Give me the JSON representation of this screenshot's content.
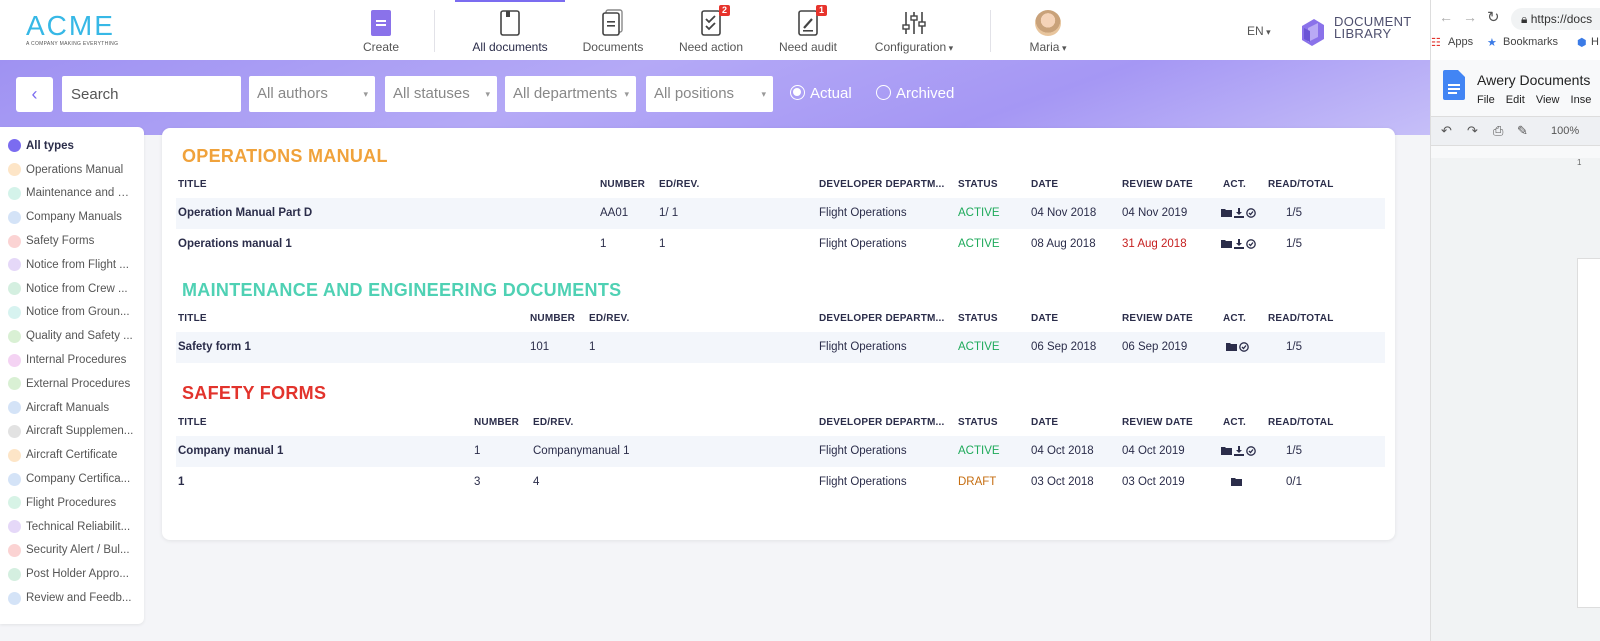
{
  "logo": {
    "word": "ACME",
    "tagline": "A COMPANY MAKING EVERYTHING"
  },
  "nav": {
    "create": "Create",
    "all_documents": "All documents",
    "documents": "Documents",
    "need_action": "Need action",
    "need_action_badge": "2",
    "need_audit": "Need audit",
    "need_audit_badge": "1",
    "configuration": "Configuration",
    "user": "Maria",
    "language": "EN",
    "doclib_line1": "DOCUMENT",
    "doclib_line2": "LIBRARY"
  },
  "filters": {
    "search_placeholder": "Search",
    "authors": "All authors",
    "statuses": "All statuses",
    "departments": "All departments",
    "positions": "All positions",
    "actual": "Actual",
    "archived": "Archived",
    "selected_view": "Actual"
  },
  "sidebar": {
    "items": [
      {
        "label": "All types",
        "color": "#7b6cf0"
      },
      {
        "label": "Operations Manual",
        "color": "#fde5c7"
      },
      {
        "label": "Maintenance and E...",
        "color": "#d4f3ea"
      },
      {
        "label": "Company Manuals",
        "color": "#d4e3f7"
      },
      {
        "label": "Safety Forms",
        "color": "#fbd3d3"
      },
      {
        "label": "Notice from Flight ...",
        "color": "#e5d8f8"
      },
      {
        "label": "Notice from Crew ...",
        "color": "#d4efe0"
      },
      {
        "label": "Notice from Groun...",
        "color": "#d7f3f0"
      },
      {
        "label": "Quality and Safety ...",
        "color": "#d9f0d4"
      },
      {
        "label": "Internal Procedures",
        "color": "#f4d3f3"
      },
      {
        "label": "External Procedures",
        "color": "#d9f0d4"
      },
      {
        "label": "Aircraft Manuals",
        "color": "#d4e3f7"
      },
      {
        "label": "Aircraft Supplemen...",
        "color": "#e2e2e2"
      },
      {
        "label": "Aircraft Certificate",
        "color": "#fde5c7"
      },
      {
        "label": "Company Certifica...",
        "color": "#d4e3f7"
      },
      {
        "label": "Flight Procedures",
        "color": "#d7f3e6"
      },
      {
        "label": "Technical Reliabilit...",
        "color": "#e5d8f8"
      },
      {
        "label": "Security Alert / Bul...",
        "color": "#fbd3d3"
      },
      {
        "label": "Post Holder Appro...",
        "color": "#d4efe0"
      },
      {
        "label": "Review and Feedb...",
        "color": "#d4e3f7"
      }
    ]
  },
  "columns": {
    "title": "TITLE",
    "number": "NUMBER",
    "ed_rev": "ED/REV.",
    "developer": "DEVELOPER DEPARTM...",
    "status": "STATUS",
    "date": "DATE",
    "review_date": "REVIEW DATE",
    "act": "ACT.",
    "read_total": "READ/TOTAL"
  },
  "sections": [
    {
      "title": "OPERATIONS MANUAL",
      "color": "#f0a23b",
      "rows": [
        {
          "title": "Operation Manual Part D",
          "number": "AA01",
          "ed_rev": "1/ 1",
          "developer": "Flight Operations",
          "status": "ACTIVE",
          "date": "04 Nov 2018",
          "review_date": "04 Nov 2019",
          "read_total": "1/5"
        },
        {
          "title": "Operations manual 1",
          "number": "1",
          "ed_rev": "1",
          "developer": "Flight Operations",
          "status": "ACTIVE",
          "date": "08 Aug 2018",
          "review_date": "31 Aug 2018",
          "read_total": "1/5"
        }
      ]
    },
    {
      "title": "MAINTENANCE AND ENGINEERING DOCUMENTS",
      "color": "#4fd1b4",
      "rows": [
        {
          "title": "Safety form 1",
          "number": "101",
          "ed_rev": "1",
          "developer": "Flight Operations",
          "status": "ACTIVE",
          "date": "06 Sep 2018",
          "review_date": "06 Sep 2019",
          "read_total": "1/5"
        }
      ]
    },
    {
      "title": "SAFETY FORMS",
      "color": "#e2332c",
      "rows": [
        {
          "title": "Company manual 1",
          "number": "1",
          "ed_rev": "Companymanual 1",
          "developer": "Flight Operations",
          "status": "ACTIVE",
          "date": "04 Oct 2018",
          "review_date": "04 Oct 2019",
          "read_total": "1/5"
        },
        {
          "title": "1",
          "number": "3",
          "ed_rev": "4",
          "developer": "Flight Operations",
          "status": "DRAFT",
          "date": "03 Oct 2018",
          "review_date": "03 Oct 2019",
          "read_total": "0/1"
        }
      ]
    }
  ],
  "browser": {
    "url": "https://docs",
    "apps": "Apps",
    "bookmarks": "Bookmarks",
    "extra": "H",
    "doc_title": "Awery Documents",
    "menu": [
      "File",
      "Edit",
      "View",
      "Inse"
    ],
    "zoom": "100%",
    "ruler": "1"
  }
}
